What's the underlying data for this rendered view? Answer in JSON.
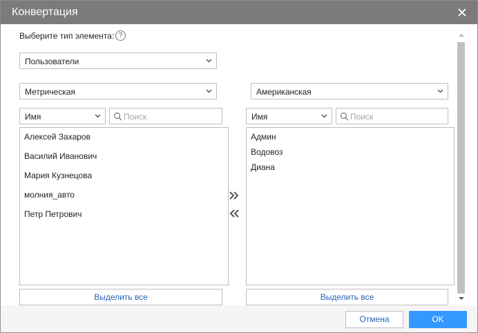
{
  "dialog": {
    "title": "Конвертация"
  },
  "element_type": {
    "label": "Выберите тип элемента:",
    "help": "?",
    "selected": "Пользователи"
  },
  "left": {
    "unit_system": "Метрическая",
    "sort_field": "Имя",
    "search_placeholder": "Поиск",
    "items": [
      "Алексей Захаров",
      "Василий Иванович",
      "Мария Кузнецова",
      "молния_авто",
      "Петр Петрович"
    ],
    "select_all": "Выделить все"
  },
  "right": {
    "unit_system": "Американская",
    "sort_field": "Имя",
    "search_placeholder": "Поиск",
    "items": [
      "Админ",
      "Водовоз",
      "Диана"
    ],
    "select_all": "Выделить все"
  },
  "footer": {
    "cancel": "Отмена",
    "ok": "OK"
  },
  "colors": {
    "titlebar": "#7b7b7b",
    "accent": "#3399ff",
    "link": "#2a63b6"
  }
}
